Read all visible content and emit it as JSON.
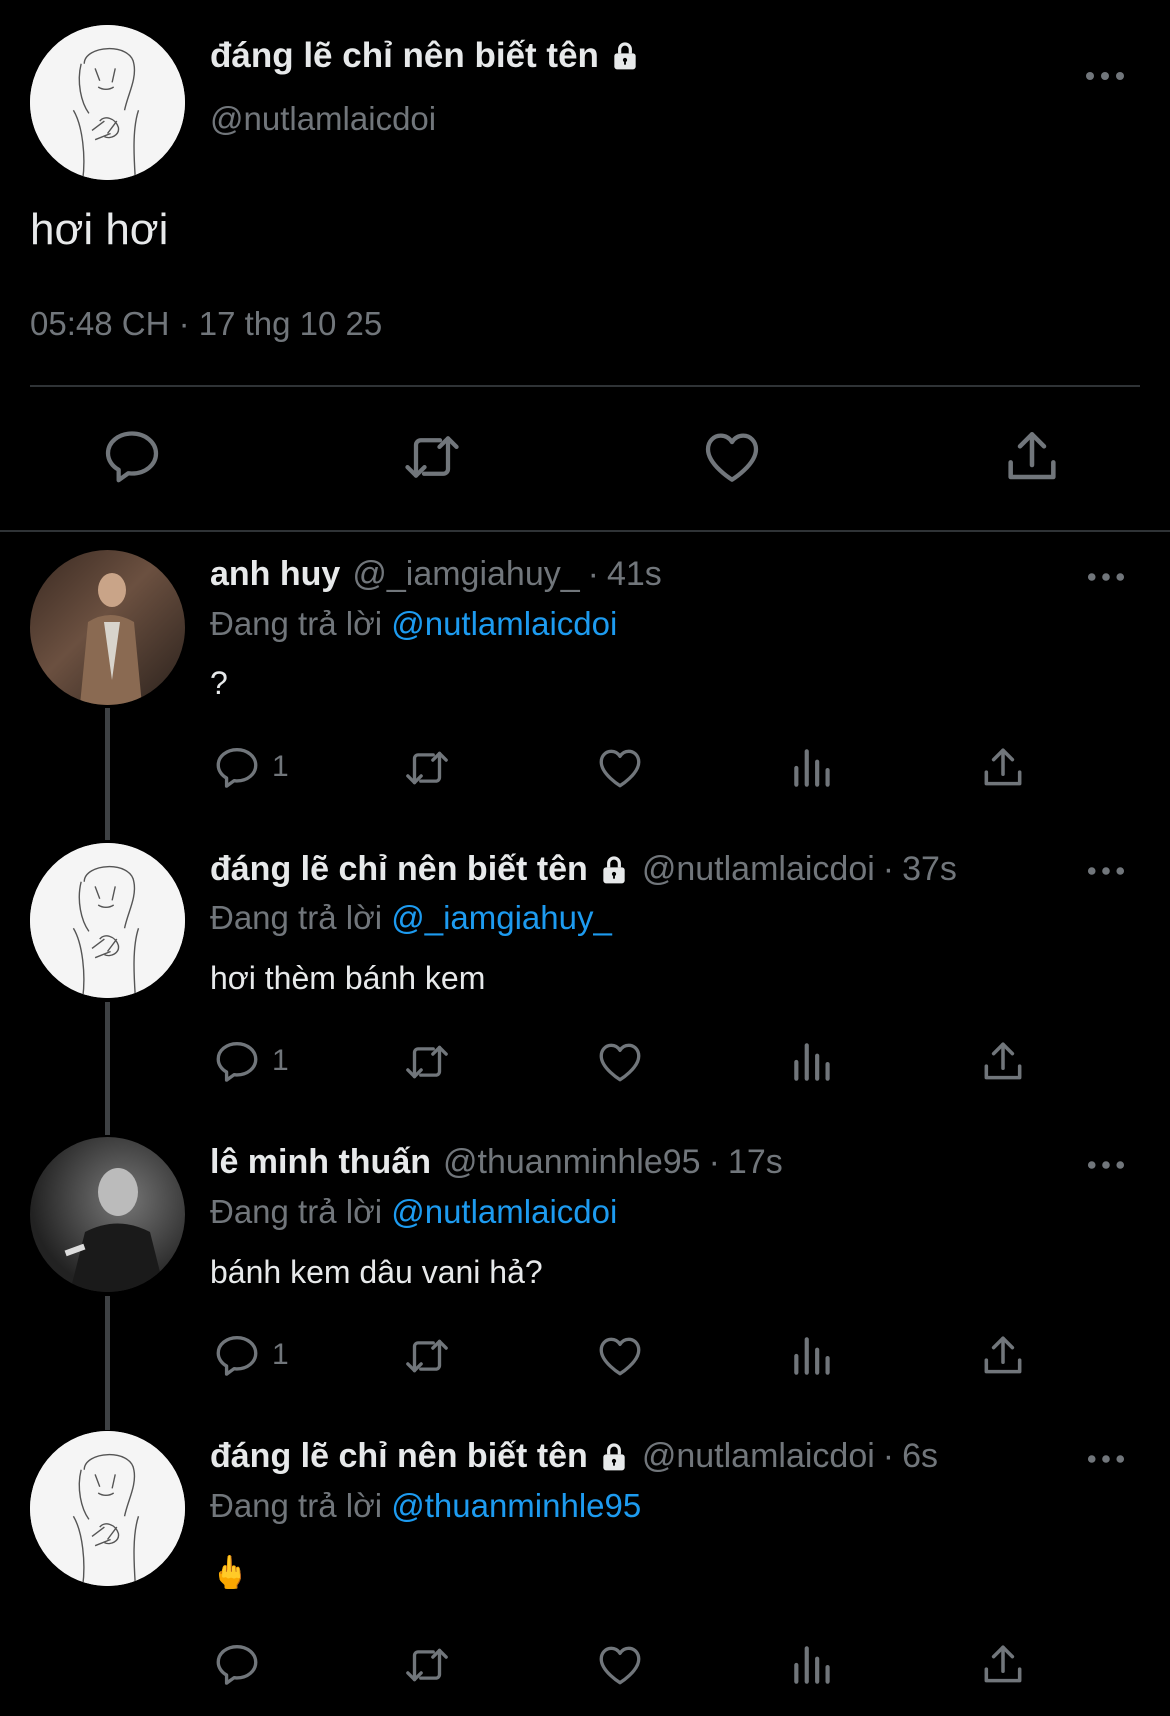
{
  "main_tweet": {
    "display_name": "đáng lẽ chỉ nên biết tên",
    "handle": "@nutlamlaicdoi",
    "text": "hơi hơi",
    "meta": "05:48 CH · 17 thg 10 25",
    "avatar_icon": "sketch-avatar-icon"
  },
  "replies": [
    {
      "display_name": "anh huy",
      "handle": "@_iamgiahuy_",
      "time": "41s",
      "replying_prefix": "Đang trả lời",
      "replying_to": "@nutlamlaicdoi",
      "text": "?",
      "reply_count": "1",
      "locked": false
    },
    {
      "display_name": "đáng lẽ chỉ nên biết tên",
      "handle": "@nutlamlaicdoi",
      "time": "37s",
      "replying_prefix": "Đang trả lời",
      "replying_to": "@_iamgiahuy_",
      "text": "hơi thèm bánh kem",
      "reply_count": "1",
      "locked": true
    },
    {
      "display_name": "lê minh thuấn",
      "handle": "@thuanminhle95",
      "time": "17s",
      "replying_prefix": "Đang trả lời",
      "replying_to": "@nutlamlaicdoi",
      "text": "bánh kem dâu vani hả?",
      "reply_count": "1",
      "locked": false
    },
    {
      "display_name": "đáng lẽ chỉ nên biết tên",
      "handle": "@nutlamlaicdoi",
      "time": "6s",
      "replying_prefix": "Đang trả lời",
      "replying_to": "@thuanminhle95",
      "text": "🖕",
      "reply_count": "",
      "locked": true
    }
  ],
  "colors": {
    "background": "#000000",
    "text": "#e7e9ea",
    "muted": "#71767b",
    "link": "#1d9bf0",
    "divider": "#2f3336"
  }
}
